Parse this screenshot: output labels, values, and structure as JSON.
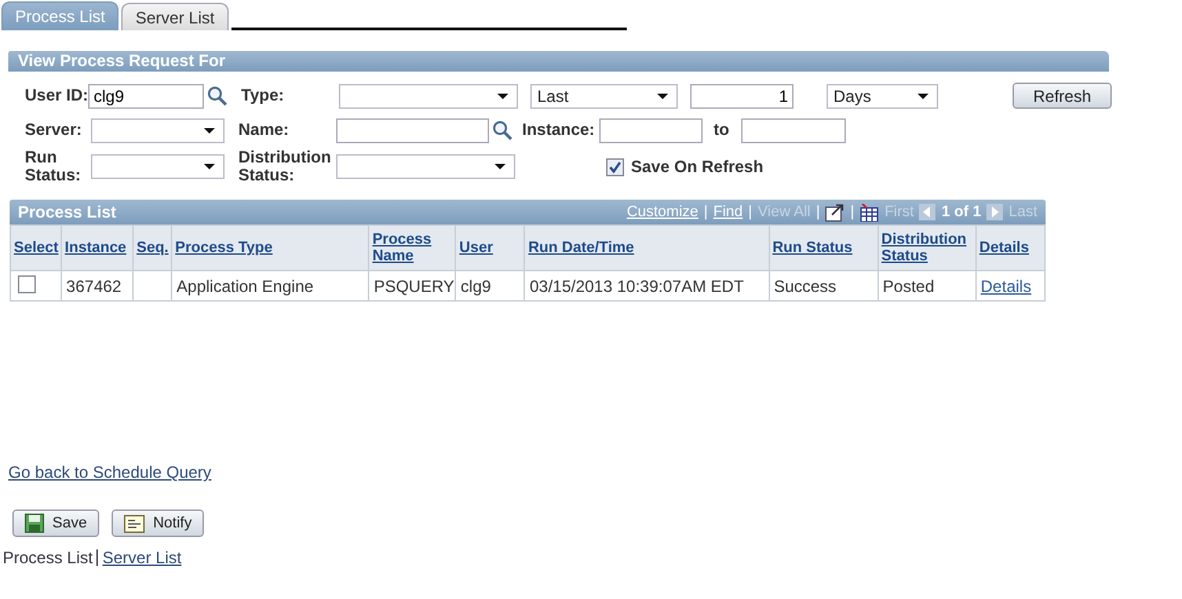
{
  "tabs": [
    {
      "label": "Process List",
      "selected": true
    },
    {
      "label": "Server List",
      "selected": false
    }
  ],
  "filter": {
    "title": "View Process Request For",
    "user_id": {
      "label": "User ID:",
      "value": "clg9"
    },
    "type": {
      "label": "Type:"
    },
    "period": {
      "value": "Last"
    },
    "count": {
      "value": "1"
    },
    "unit": {
      "value": "Days"
    },
    "refresh_button": "Refresh",
    "server": {
      "label": "Server:"
    },
    "name": {
      "label": "Name:"
    },
    "instance": {
      "label": "Instance:"
    },
    "instance_to": {
      "label": "to"
    },
    "run_status": {
      "label": "Run Status:"
    },
    "distribution_status": {
      "label": "Distribution Status:"
    },
    "save_on_refresh": {
      "label": "Save On Refresh",
      "checked": true
    }
  },
  "grid": {
    "title": "Process List",
    "toolbar": [
      {
        "kind": "link",
        "text": "Customize"
      },
      {
        "kind": "sep",
        "text": "|"
      },
      {
        "kind": "link",
        "text": "Find"
      },
      {
        "kind": "sep",
        "text": "|"
      },
      {
        "kind": "disabled",
        "text": "View All"
      },
      {
        "kind": "sep",
        "text": "|"
      },
      {
        "kind": "popout"
      },
      {
        "kind": "sep",
        "text": "|"
      },
      {
        "kind": "download"
      },
      {
        "kind": "disabled",
        "text": "First"
      },
      {
        "kind": "prev"
      },
      {
        "kind": "count",
        "text": "1 of 1"
      },
      {
        "kind": "next"
      },
      {
        "kind": "disabled",
        "text": "Last"
      }
    ],
    "columns": [
      "Select",
      "Instance",
      "Seq.",
      "Process Type",
      "Process Name",
      "User",
      "Run Date/Time",
      "Run Status",
      "Distribution Status",
      "Details"
    ],
    "rows": [
      {
        "selected": false,
        "cells": [
          "",
          "367462",
          "",
          "Application Engine",
          "PSQUERY",
          "clg9",
          "03/15/2013 10:39:07AM EDT",
          "Success",
          "Posted",
          "Details"
        ]
      }
    ]
  },
  "back_link": "Go back to Schedule Query",
  "buttons": [
    {
      "kind": "save",
      "label": "Save"
    },
    {
      "kind": "notify",
      "label": "Notify"
    }
  ],
  "footer_links": [
    {
      "text": "Process List",
      "selected": true
    },
    {
      "text": "Server List",
      "selected": false
    }
  ]
}
